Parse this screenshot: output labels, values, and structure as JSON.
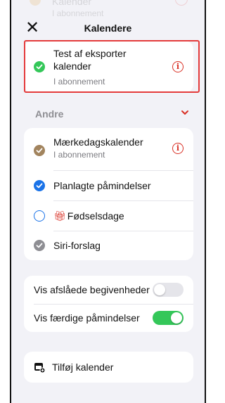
{
  "header": {
    "title": "Kalendere",
    "close_icon": "close-icon"
  },
  "ghost_row": {
    "label": "Kalender",
    "sub": "I abonnement"
  },
  "highlighted_calendar": {
    "label": "Test af eksporter kalender",
    "status": "I abonnement",
    "check_color": "#34c759",
    "info_icon": "info-icon"
  },
  "section": {
    "title": "Andre",
    "chevron_icon": "chevron-down-icon"
  },
  "other_calendars": [
    {
      "label": "Mærkedagskalender",
      "status": "I abonnement",
      "state": "checked",
      "color": "#a2845e"
    },
    {
      "label": "Planlagte påmindelser",
      "state": "checked",
      "color": "#1a73e8"
    },
    {
      "label": "Fødselsdage",
      "state": "unchecked",
      "color": "#1a73e8",
      "icon": "gift-icon"
    },
    {
      "label": "Siri-forslag",
      "state": "checked",
      "color": "#8e8e93"
    }
  ],
  "settings": [
    {
      "label": "Vis afslåede begivenheder",
      "on": false
    },
    {
      "label": "Vis færdige påmindelser",
      "on": true
    }
  ],
  "footer": {
    "add_label": "Tilføj kalender",
    "add_icon": "add-calendar-icon"
  },
  "colors": {
    "on": "#34c759",
    "off": "#e5e5ea",
    "accent_red": "#d93025"
  }
}
